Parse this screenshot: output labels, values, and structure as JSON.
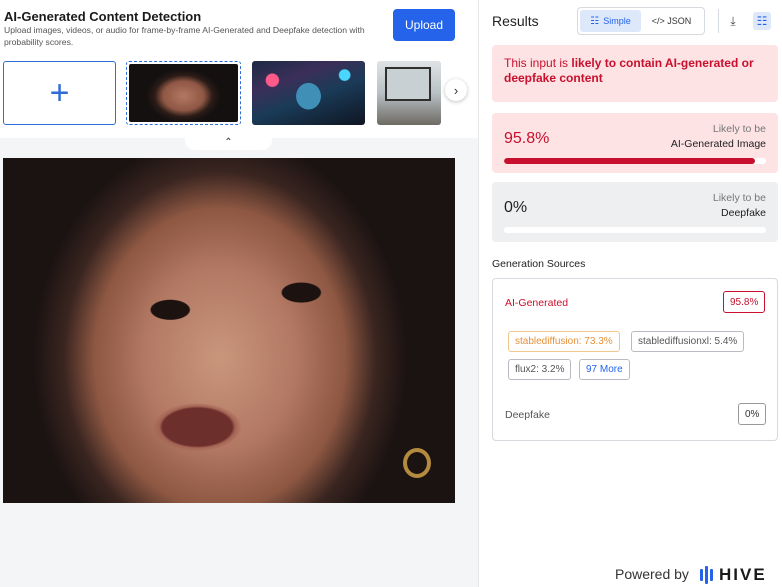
{
  "header": {
    "title": "AI-Generated Content Detection",
    "subtitle": "Upload images, videos, or audio for frame-by-frame AI-Generated and Deepfake detection with probability scores.",
    "upload_label": "Upload"
  },
  "thumbnails": {
    "add_symbol": "+",
    "next_symbol": "›",
    "collapse_symbol": "⌃"
  },
  "results": {
    "title": "Results",
    "view_simple": "Simple",
    "view_json": "</> JSON",
    "alert_prefix": "This input is ",
    "alert_text": "likely to contain AI-generated or deepfake content",
    "ai_score": {
      "value": "95.8%",
      "label_line1": "Likely to be",
      "label_line2": "AI-Generated Image",
      "fraction": 0.958
    },
    "deepfake_score": {
      "value": "0%",
      "label_line1": "Likely to be",
      "label_line2": "Deepfake",
      "fraction": 0
    },
    "generation_sources": {
      "title": "Generation Sources",
      "ai_label": "AI-Generated",
      "ai_pct": "95.8%",
      "chips": {
        "sd": "stablediffusion: 73.3%",
        "sdxl": "stablediffusionxl: 5.4%",
        "flux": "flux2: 3.2%",
        "more": "97 More"
      },
      "deepfake_label": "Deepfake",
      "deepfake_pct": "0%"
    },
    "footer_powered": "Powered by",
    "footer_brand": "HIVE"
  },
  "colors": {
    "accent_blue": "#2563eb",
    "danger_red": "#c8102e"
  }
}
